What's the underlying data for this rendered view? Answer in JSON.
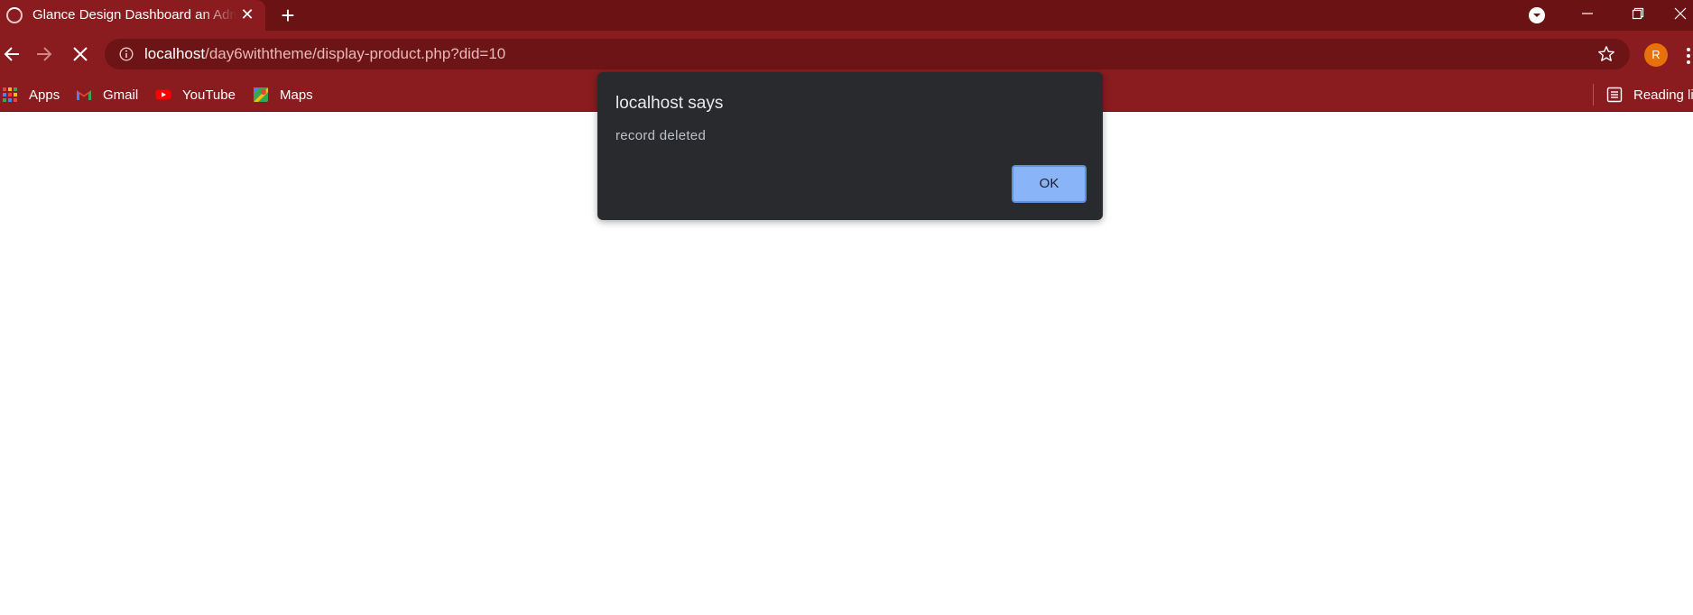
{
  "browser": {
    "tab": {
      "title": "Glance Design Dashboard an Admin Panel"
    },
    "url": {
      "host": "localhost",
      "path": "/day6withtheme/display-product.php?did=10"
    },
    "profile_initial": "R"
  },
  "bookmarks": {
    "items": [
      {
        "label": "Apps",
        "icon": "apps-grid-icon"
      },
      {
        "label": "Gmail",
        "icon": "gmail-icon"
      },
      {
        "label": "YouTube",
        "icon": "youtube-icon"
      },
      {
        "label": "Maps",
        "icon": "maps-icon"
      }
    ],
    "reading_list": "Reading list"
  },
  "dialog": {
    "title": "localhost says",
    "message": "record deleted",
    "ok_label": "OK"
  },
  "colors": {
    "tabstrip": "#6b1214",
    "toolbar": "#8a1c1f",
    "dialog_bg": "#292a2d",
    "ok_button": "#8ab4f8",
    "avatar": "#e8710a"
  }
}
